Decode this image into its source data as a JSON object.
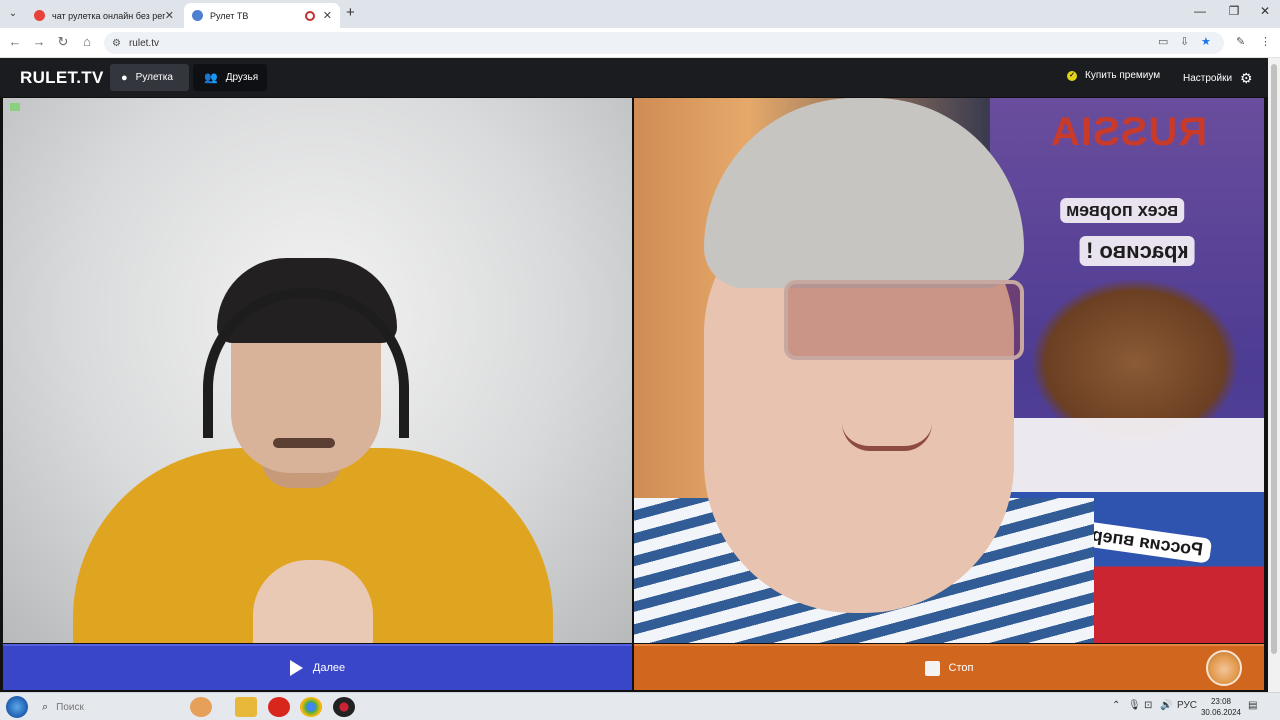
{
  "browser": {
    "tabs": [
      {
        "title": "чат рулетка онлайн без регис",
        "active": false
      },
      {
        "title": "Рулет ТВ",
        "active": true
      }
    ],
    "url": "rulet.tv"
  },
  "site": {
    "logo": "RULET.TV",
    "nav": {
      "roulette": "Рулетка",
      "friends": "Друзья"
    },
    "premium": "Купить премиум",
    "settings": "Настройки"
  },
  "poster": {
    "title": "RUSSIA",
    "line1": "всех порвем",
    "line2": "красиво !",
    "line3": "Россия вперед!"
  },
  "actions": {
    "next": "Далее",
    "stop": "Стоп"
  },
  "taskbar": {
    "search_placeholder": "Поиск",
    "lang": "РУС",
    "time": "23:08",
    "date": "30.06.2024"
  },
  "colors": {
    "next_button": "#3a46c9",
    "stop_button": "#d1661f",
    "header": "#1b1c20"
  }
}
